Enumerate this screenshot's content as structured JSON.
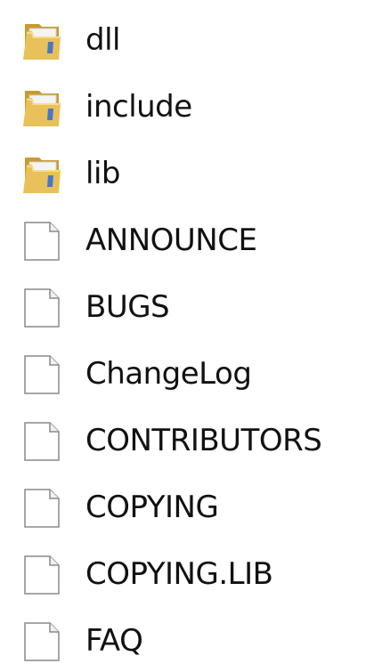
{
  "items": [
    {
      "name": "dll",
      "type": "folder",
      "icon": "folder-icon"
    },
    {
      "name": "include",
      "type": "folder",
      "icon": "folder-icon"
    },
    {
      "name": "lib",
      "type": "folder",
      "icon": "folder-icon"
    },
    {
      "name": "ANNOUNCE",
      "type": "file",
      "icon": "file-icon"
    },
    {
      "name": "BUGS",
      "type": "file",
      "icon": "file-icon"
    },
    {
      "name": "ChangeLog",
      "type": "file",
      "icon": "file-icon"
    },
    {
      "name": "CONTRIBUTORS",
      "type": "file",
      "icon": "file-icon"
    },
    {
      "name": "COPYING",
      "type": "file",
      "icon": "file-icon"
    },
    {
      "name": "COPYING.LIB",
      "type": "file",
      "icon": "file-icon"
    },
    {
      "name": "FAQ",
      "type": "file",
      "icon": "file-icon"
    }
  ],
  "colors": {
    "folder_front": "#e8c15a",
    "folder_back": "#c99a2e",
    "folder_highlight": "#f6dc8c",
    "folder_paper": "#f4f4f4",
    "file_border": "#8a8a8a",
    "file_fill": "#ffffff",
    "text": "#111111"
  }
}
